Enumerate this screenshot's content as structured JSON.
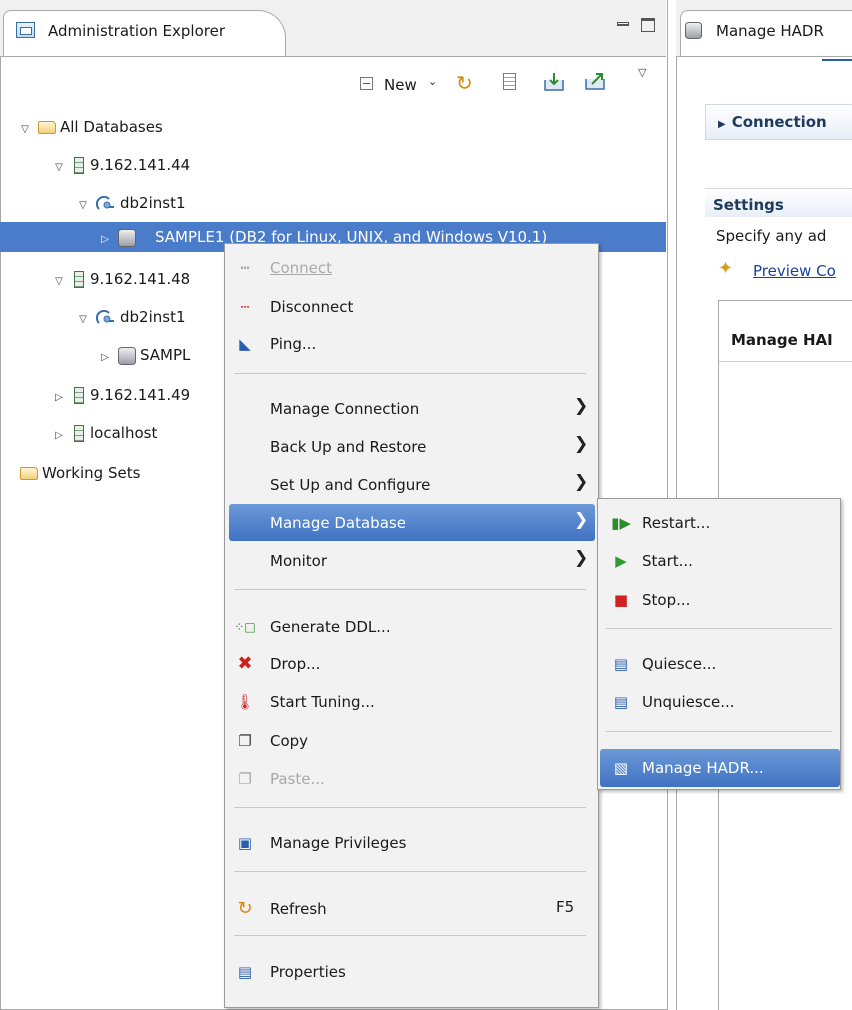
{
  "left_view": {
    "tab_title": "Administration Explorer",
    "toolbar": {
      "new_label": "New",
      "new_arrow": "⌄",
      "view_menu_arrow": "▽"
    }
  },
  "tree": {
    "expanded": "▽",
    "collapsed": "▷",
    "all_databases": "All Databases",
    "host1": "9.162.141.44",
    "host1_instance": "db2inst1",
    "host1_db": "SAMPLE1 (DB2 for Linux, UNIX, and Windows V10.1)",
    "host2": "9.162.141.48",
    "host2_instance": "db2inst1",
    "host2_db": "SAMPL",
    "host3": "9.162.141.49",
    "host4": "localhost",
    "working_sets": "Working Sets"
  },
  "right_view": {
    "tab_title": "Manage HADR",
    "connection_section": "Connection",
    "settings_section": "Settings",
    "settings_desc": "Specify any ad",
    "preview_link": "Preview Co",
    "panel_title": "Manage HAI"
  },
  "context_menu": {
    "connect": "Connect",
    "disconnect": "Disconnect",
    "ping": "Ping...",
    "manage_connection": "Manage Connection",
    "backup_restore": "Back Up and Restore",
    "setup_configure": "Set Up and Configure",
    "manage_database": "Manage Database",
    "monitor": "Monitor",
    "generate_ddl": "Generate DDL...",
    "drop": "Drop...",
    "start_tuning": "Start Tuning...",
    "copy": "Copy",
    "paste": "Paste...",
    "manage_privileges": "Manage Privileges",
    "refresh": "Refresh",
    "refresh_shortcut": "F5",
    "properties": "Properties",
    "submenu_arrow": "❯"
  },
  "submenu": {
    "restart": "Restart...",
    "start": "Start...",
    "stop": "Stop...",
    "quiesce": "Quiesce...",
    "unquiesce": "Unquiesce...",
    "manage_hadr": "Manage HADR..."
  },
  "colors": {
    "selection": "#4a7cc9",
    "menu_bg": "#f2f2f2",
    "link": "#1a3fa0"
  }
}
